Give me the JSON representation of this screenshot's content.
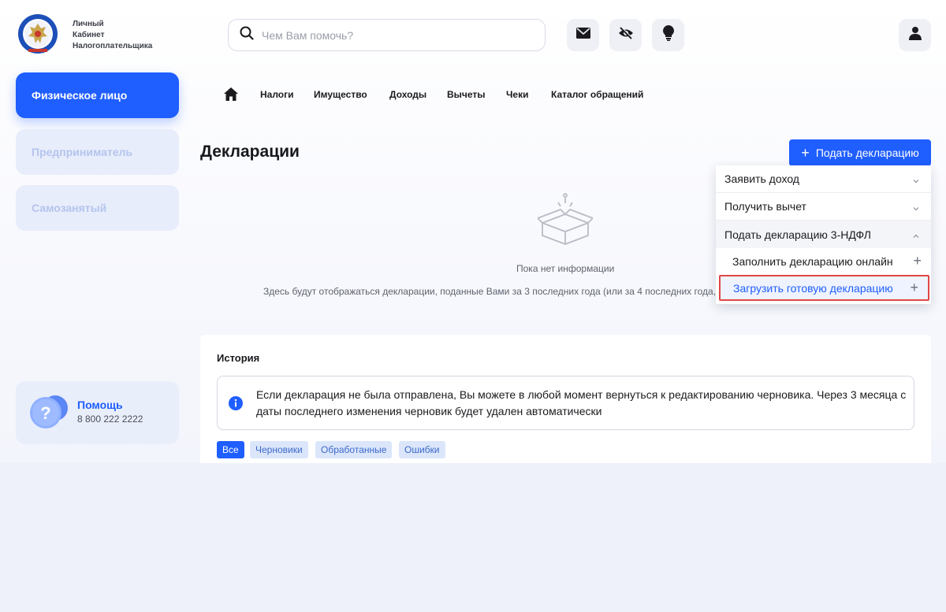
{
  "header": {
    "brand_lines": [
      "Личный",
      "Кабинет",
      "Налогоплательщика"
    ],
    "search_placeholder": "Чем Вам помочь?",
    "icons": [
      "mail-icon",
      "eye-off-icon",
      "lightbulb-icon",
      "user-icon"
    ]
  },
  "sidebar": {
    "items": [
      {
        "label": "Физическое лицо",
        "active": true
      },
      {
        "label": "Предприниматель",
        "active": false
      },
      {
        "label": "Самозанятый",
        "active": false
      }
    ],
    "help": {
      "title": "Помощь",
      "phone": "8 800 222 2222"
    }
  },
  "nav": {
    "items": [
      "Налоги",
      "Имущество",
      "Доходы",
      "Вычеты",
      "Чеки",
      "Каталог обращений"
    ]
  },
  "main": {
    "title": "Декларации",
    "submit_button": "Подать декларацию",
    "empty": {
      "title": "Пока нет информации",
      "description": "Здесь будут отображаться декларации, поданные Вами за 3 последних года (или за 4 последних года,"
    }
  },
  "dropdown": {
    "items": [
      {
        "label": "Заявить доход"
      },
      {
        "label": "Получить вычет"
      },
      {
        "label": "Подать декларацию 3-НДФЛ"
      },
      {
        "label": "Заполнить декларацию онлайн"
      },
      {
        "label": "Загрузить готовую декларацию"
      }
    ]
  },
  "history": {
    "title": "История",
    "info": "Если декларация не была отправлена, Вы можете в любой момент вернуться к редактированию черновика. Через 3 месяца с даты последнего изменения черновик будет удален автоматически",
    "filters": [
      "Все",
      "Черновики",
      "Обработанные",
      "Ошибки"
    ]
  },
  "colors": {
    "accent": "#1f5eff",
    "highlight_border": "#e04646"
  }
}
